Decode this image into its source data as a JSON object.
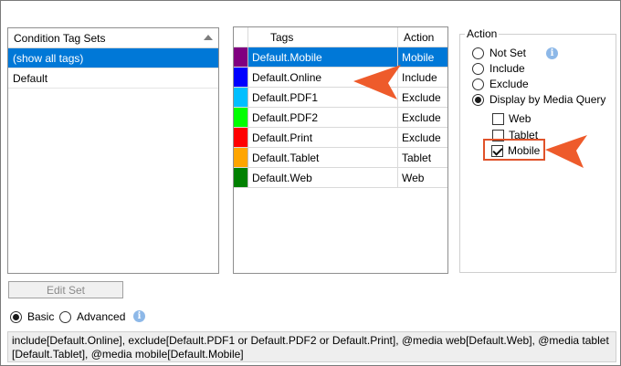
{
  "condition_tag_sets": {
    "header": "Condition Tag Sets",
    "items": [
      {
        "label": "(show all tags)",
        "selected": true
      },
      {
        "label": "Default",
        "selected": false
      }
    ]
  },
  "tags_table": {
    "headers": {
      "tags": "Tags",
      "action": "Action"
    },
    "rows": [
      {
        "tag": "Default.Mobile",
        "action": "Mobile",
        "color": "#800080",
        "selected": true
      },
      {
        "tag": "Default.Online",
        "action": "Include",
        "color": "#0000ff",
        "selected": false
      },
      {
        "tag": "Default.PDF1",
        "action": "Exclude",
        "color": "#00bfff",
        "selected": false
      },
      {
        "tag": "Default.PDF2",
        "action": "Exclude",
        "color": "#00ff00",
        "selected": false
      },
      {
        "tag": "Default.Print",
        "action": "Exclude",
        "color": "#ff0000",
        "selected": false
      },
      {
        "tag": "Default.Tablet",
        "action": "Tablet",
        "color": "#ffa500",
        "selected": false
      },
      {
        "tag": "Default.Web",
        "action": "Web",
        "color": "#008000",
        "selected": false
      }
    ]
  },
  "action_panel": {
    "title": "Action",
    "options": {
      "not_set": "Not Set",
      "include": "Include",
      "exclude": "Exclude",
      "display_by_media_query": "Display by Media Query"
    },
    "selected": "display_by_media_query",
    "media": {
      "web": "Web",
      "tablet": "Tablet",
      "mobile": "Mobile"
    },
    "media_checked": {
      "web": false,
      "tablet": false,
      "mobile": true
    }
  },
  "edit_set_label": "Edit Set",
  "mode": {
    "basic": "Basic",
    "advanced": "Advanced",
    "selected": "basic"
  },
  "expression_lines": [
    "include[Default.Online], exclude[Default.PDF1 or Default.PDF2 or Default.Print], @media web[Default.Web], @media tablet",
    "[Default.Tablet], @media mobile[Default.Mobile]"
  ],
  "colors": {
    "selection": "#0078d7",
    "callout": "#ee5b2b",
    "info": "#8db8e8"
  }
}
